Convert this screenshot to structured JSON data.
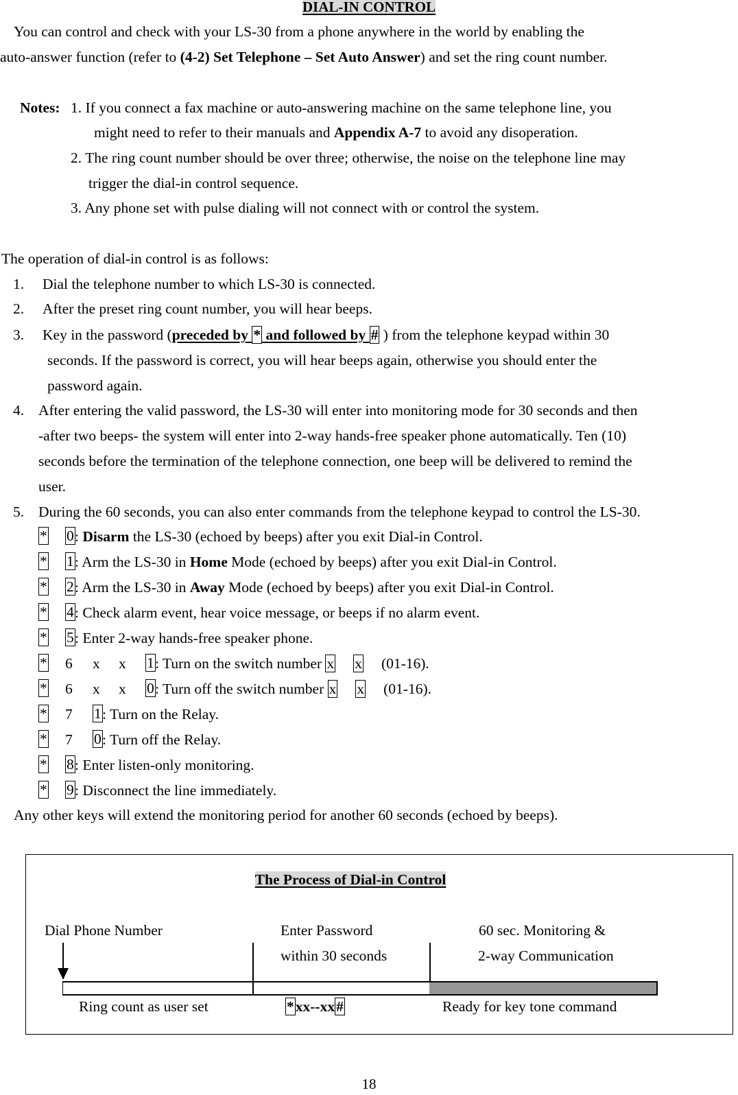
{
  "title": "DIAL-IN CONTROL",
  "intro": {
    "line1": "You can control and check with your LS-30 from a phone anywhere in the world by enabling the",
    "line2_pre": "auto-answer function (refer to ",
    "line2_bold": "(4-2) Set Telephone – Set Auto Answer",
    "line2_post": ") and set the ring count number."
  },
  "notes": {
    "label": "Notes:",
    "items": [
      {
        "line1": "1. If you connect a fax machine or auto-answering machine on the same telephone line, you",
        "line2_pre": "might need to refer to their manuals and ",
        "line2_bold": "Appendix A-7",
        "line2_post": " to avoid any disoperation."
      },
      {
        "line1": "2. The ring count number should be over three; otherwise, the noise on the telephone line may",
        "line2": "trigger the dial-in control sequence."
      },
      {
        "line1": "3. Any phone set with pulse dialing will not connect with or control the system."
      }
    ]
  },
  "operation": {
    "heading": "The operation of dial-in control is as follows:",
    "steps": [
      {
        "num": "1.",
        "lines": [
          "Dial the telephone number to which LS-30 is connected."
        ]
      },
      {
        "num": "2.",
        "lines": [
          "After the preset ring count number, you will hear beeps."
        ]
      },
      {
        "num": "3.",
        "pre": "Key in the password (",
        "u1": "preceded by ",
        "k1": "*",
        "u2": " and followed by ",
        "k2": "#",
        "post": " ) from the telephone keypad within 30",
        "lines": [
          "seconds. If the password is correct, you will hear beeps again, otherwise you should enter the",
          "password again."
        ]
      },
      {
        "num": "4.",
        "lines": [
          "After entering the valid password, the LS-30 will enter into monitoring mode for 30 seconds and then",
          "-after two beeps- the system will enter into 2-way hands-free speaker phone automatically. Ten (10)",
          "seconds before the termination of the telephone connection, one beep will be delivered to remind the",
          "user."
        ]
      },
      {
        "num": "5.",
        "lines": [
          "During the 60 seconds, you can also enter commands from the telephone keypad to control the LS-30."
        ]
      }
    ]
  },
  "commands": [
    {
      "keys": [
        "*",
        "0"
      ],
      "pre": " : ",
      "bold": "Disarm",
      "post": " the LS-30 (echoed by beeps) after you exit Dial-in Control."
    },
    {
      "keys": [
        "*",
        "1"
      ],
      "pre": " : Arm the LS-30 in ",
      "bold": "Home",
      "post": " Mode (echoed by beeps) after you exit Dial-in Control."
    },
    {
      "keys": [
        "*",
        "2"
      ],
      "pre": " : Arm the LS-30 in ",
      "bold": "Away",
      "post": " Mode (echoed by beeps) after you exit Dial-in Control."
    },
    {
      "keys": [
        "*",
        "4"
      ],
      "pre": " : Check alarm event, hear voice message, or beeps if no alarm event.",
      "bold": "",
      "post": ""
    },
    {
      "keys": [
        "*",
        "5"
      ],
      "pre": " : Enter 2-way hands-free speaker phone.",
      "bold": "",
      "post": ""
    },
    {
      "keys": [
        "*",
        "6",
        "x",
        "x",
        "1"
      ],
      "pre": " : Turn on the switch number ",
      "bold": "",
      "post": "",
      "tail_keys": [
        "x",
        "x"
      ],
      "tail": "(01-16)."
    },
    {
      "keys": [
        "*",
        "6",
        "x",
        "x",
        "0"
      ],
      "pre": " : Turn off the switch number ",
      "bold": "",
      "post": "",
      "tail_keys": [
        "x",
        "x"
      ],
      "tail": "(01-16)."
    },
    {
      "keys": [
        "*",
        "7",
        "1"
      ],
      "pre": " : Turn on the Relay.",
      "bold": "",
      "post": ""
    },
    {
      "keys": [
        "*",
        "7",
        "0"
      ],
      "pre": " : Turn off the Relay.",
      "bold": "",
      "post": ""
    },
    {
      "keys": [
        "*",
        "8"
      ],
      "pre": " : Enter listen-only monitoring.",
      "bold": "",
      "post": ""
    },
    {
      "keys": [
        "*",
        "9"
      ],
      "pre": " : Disconnect the line immediately.",
      "bold": "",
      "post": ""
    }
  ],
  "other_keys": "Any other keys will extend the monitoring period for another 60 seconds (echoed by beeps).",
  "process": {
    "title": "The Process of Dial-in Control",
    "stages": [
      {
        "top": [
          "Dial Phone Number"
        ],
        "bottom": "Ring count as user set"
      },
      {
        "top": [
          "Enter Password",
          "within 30 seconds"
        ],
        "bottom_k1": "*",
        "bottom_mid": "xx--xx",
        "bottom_k2": "#"
      },
      {
        "top": [
          "60 sec. Monitoring &",
          "2-way Communication"
        ],
        "bottom": "Ready for key tone command"
      }
    ],
    "colors": {
      "active_segment": "#969696"
    }
  },
  "page_number": "18"
}
